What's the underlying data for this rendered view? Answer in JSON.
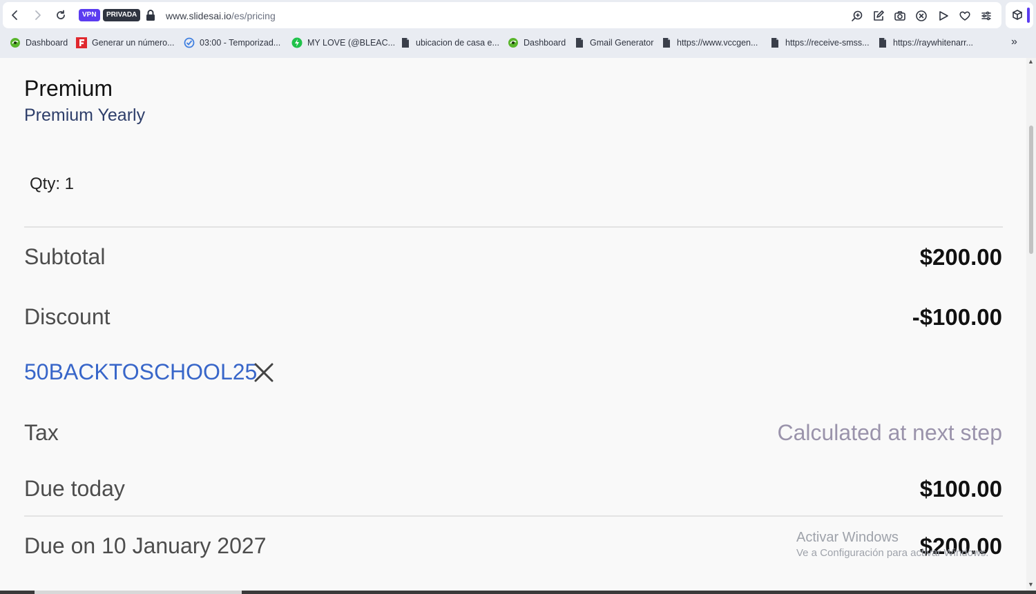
{
  "browser": {
    "badge_vpn": "VPN",
    "badge_private": "PRIVADA",
    "url_host": "www.slidesai.io",
    "url_path": "/es/pricing",
    "accent": "#5b3cf0"
  },
  "bookmarks": [
    {
      "label": "Dashboard",
      "icon": "green-globe-icon"
    },
    {
      "label": "Generar un número...",
      "icon": "red-f-icon"
    },
    {
      "label": "03:00 - Temporizad...",
      "icon": "blue-check-icon"
    },
    {
      "label": "MY LOVE (@BLEAC...",
      "icon": "green-bolt-icon"
    },
    {
      "label": "ubicacion de casa e...",
      "icon": "page-icon"
    },
    {
      "label": "Dashboard",
      "icon": "green-globe-icon"
    },
    {
      "label": "Gmail Generator",
      "icon": "page-icon"
    },
    {
      "label": "https://www.vccgen...",
      "icon": "page-icon"
    },
    {
      "label": "https://receive-smss...",
      "icon": "page-icon"
    },
    {
      "label": "https://raywhitenarr...",
      "icon": "page-icon"
    }
  ],
  "order": {
    "plan": "Premium",
    "plan_variant": "Premium Yearly",
    "quantity": "Qty: 1",
    "subtotal_label": "Subtotal",
    "subtotal_value": "$200.00",
    "discount_label": "Discount",
    "discount_value": "-$100.00",
    "coupon_code": "50BACKTOSCHOOL25",
    "tax_label": "Tax",
    "tax_value": "Calculated at next step",
    "due_today_label": "Due today",
    "due_today_value": "$100.00",
    "due_later_label": "Due on 10 January 2027",
    "due_later_value": "$200.00"
  },
  "watermark": {
    "line1": "Activar Windows",
    "line2": "Ve a Configuración para activar Windows."
  }
}
